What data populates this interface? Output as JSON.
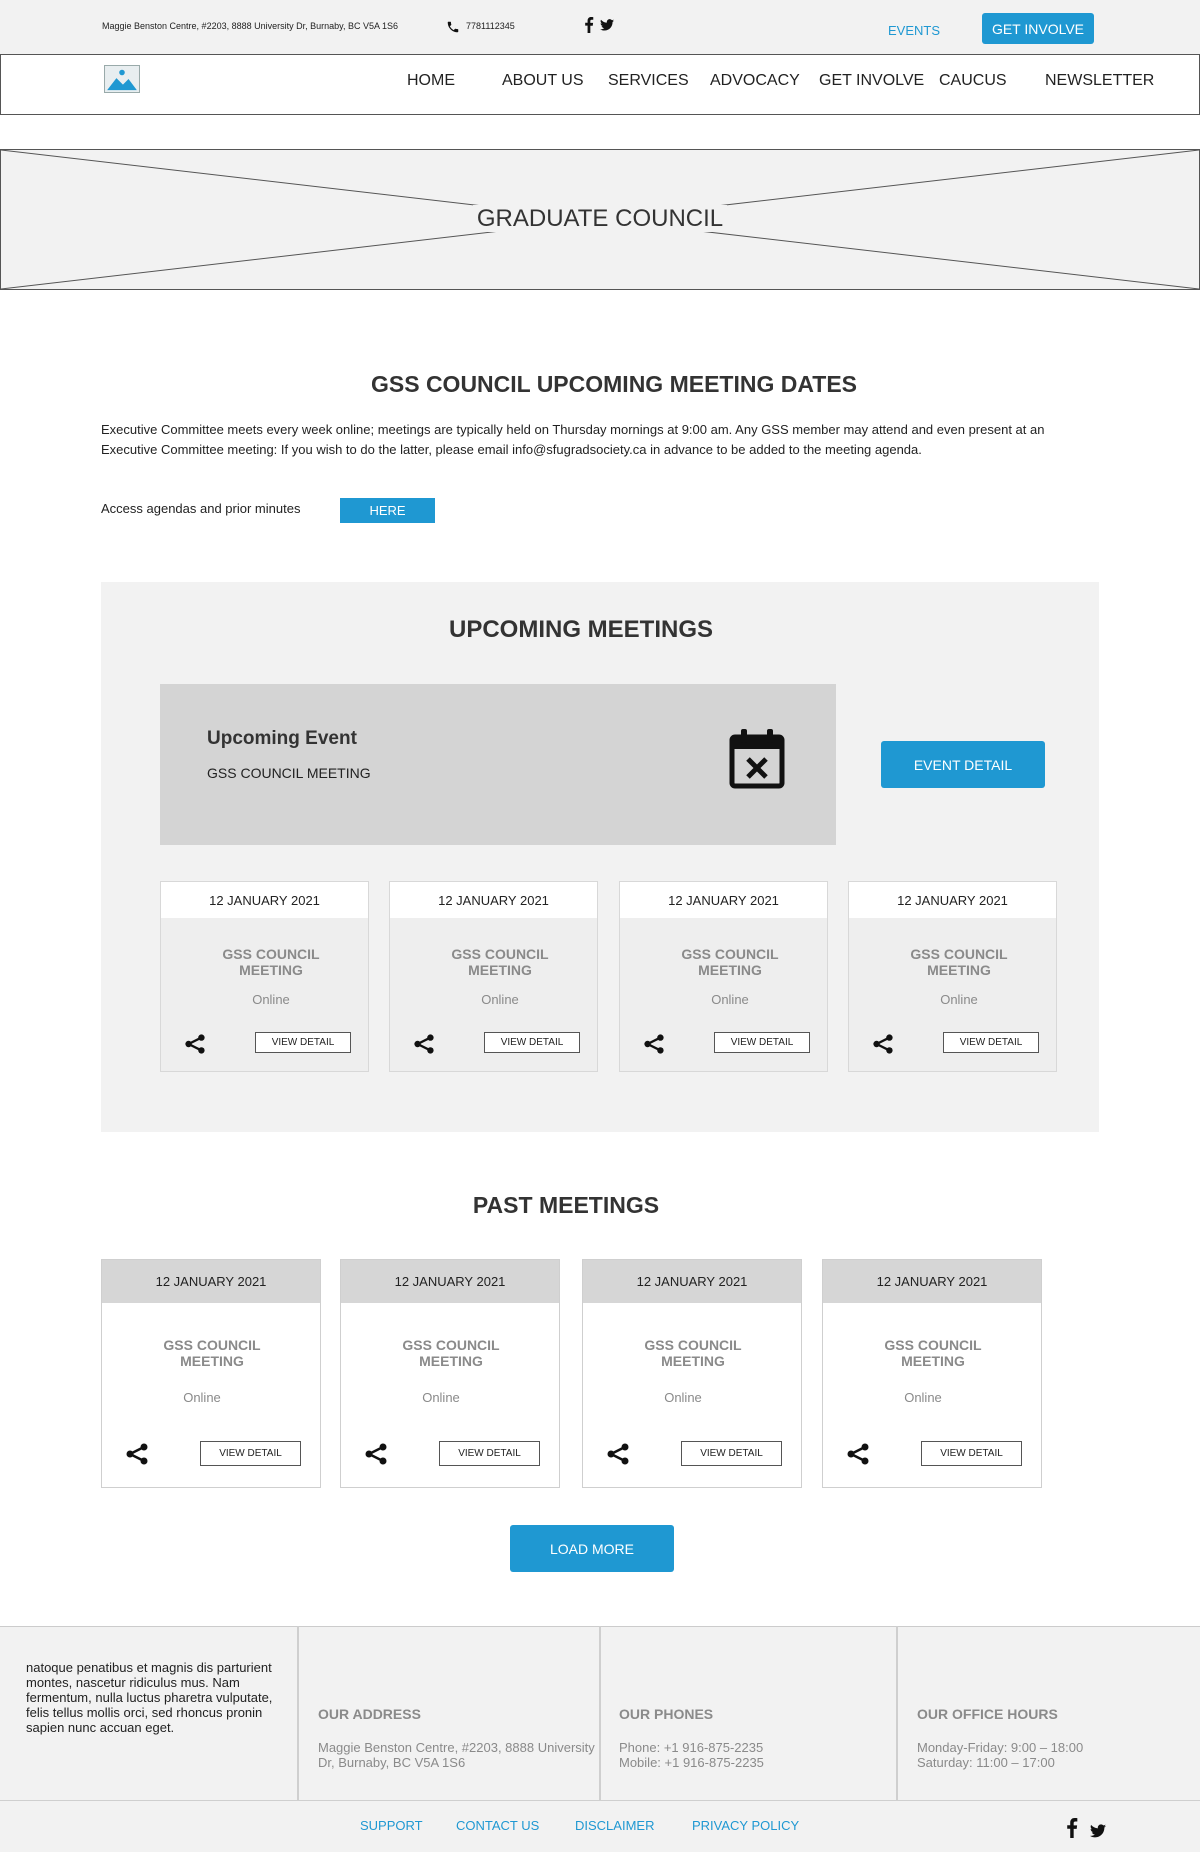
{
  "topbar": {
    "address": "Maggie Benston Centre, #2203, 8888 University Dr, Burnaby, BC V5A 1S6",
    "phone": "7781112345",
    "events_link": "EVENTS",
    "get_involve_button": "GET INVOLVE"
  },
  "nav": {
    "items": [
      "HOME",
      "ABOUT US",
      "SERVICES",
      "ADVOCACY",
      "GET INVOLVE",
      "CAUCUS",
      "NEWSLETTER"
    ]
  },
  "hero": {
    "title": "GRADUATE COUNCIL"
  },
  "meeting_dates": {
    "title": "GSS COUNCIL UPCOMING MEETING DATES",
    "description": "Executive Committee meets every week online; meetings are typically held on Thursday mornings at 9:00 am. Any GSS member may attend and even present at an Executive Committee meeting: If you wish to do the latter, please email info@sfugradsociety.ca in advance to be added to the meeting agenda.",
    "access_label": "Access agendas and prior minutes",
    "here_button": "HERE"
  },
  "upcoming": {
    "title": "UPCOMING MEETINGS",
    "featured": {
      "heading": "Upcoming Event",
      "name": "GSS COUNCIL MEETING",
      "detail_button": "EVENT DETAIL"
    },
    "cards": [
      {
        "date": "12 JANUARY 2021",
        "title": "GSS COUNCIL MEETING",
        "location": "Online",
        "button": "VIEW DETAIL"
      },
      {
        "date": "12 JANUARY 2021",
        "title": "GSS COUNCIL MEETING",
        "location": "Online",
        "button": "VIEW DETAIL"
      },
      {
        "date": "12 JANUARY 2021",
        "title": "GSS COUNCIL MEETING",
        "location": "Online",
        "button": "VIEW DETAIL"
      },
      {
        "date": "12 JANUARY 2021",
        "title": "GSS COUNCIL MEETING",
        "location": "Online",
        "button": "VIEW DETAIL"
      }
    ]
  },
  "past": {
    "title": "PAST MEETINGS",
    "cards": [
      {
        "date": "12 JANUARY 2021",
        "title": "GSS COUNCIL MEETING",
        "location": "Online",
        "button": "VIEW DETAIL"
      },
      {
        "date": "12 JANUARY 2021",
        "title": "GSS COUNCIL MEETING",
        "location": "Online",
        "button": "VIEW DETAIL"
      },
      {
        "date": "12 JANUARY 2021",
        "title": "GSS COUNCIL MEETING",
        "location": "Online",
        "button": "VIEW DETAIL"
      },
      {
        "date": "12 JANUARY 2021",
        "title": "GSS COUNCIL MEETING",
        "location": "Online",
        "button": "VIEW DETAIL"
      }
    ],
    "load_more_button": "LOAD MORE"
  },
  "footer": {
    "about": "natoque penatibus et magnis dis parturient montes, nascetur ridiculus mus. Nam fermentum, nulla luctus pharetra vulputate, felis tellus mollis orci, sed rhoncus pronin sapien nunc accuan eget.",
    "address": {
      "heading": "OUR ADDRESS",
      "line1": "Maggie Benston Centre, #2203, 8888 University",
      "line2": "Dr, Burnaby, BC V5A 1S6"
    },
    "phones": {
      "heading": "OUR PHONES",
      "phone": "Phone: +1 916-875-2235",
      "mobile": "Mobile: +1 916-875-2235"
    },
    "hours": {
      "heading": "OUR OFFICE HOURS",
      "weekdays": "Monday-Friday: 9:00 – 18:00",
      "saturday": "Saturday: 11:00 – 17:00"
    },
    "links": [
      "SUPPORT",
      "CONTACT US",
      "DISCLAIMER",
      "PRIVACY POLICY"
    ]
  },
  "icons": {
    "phone": "phone-icon",
    "facebook": "facebook-icon",
    "twitter": "twitter-icon",
    "logo": "image-placeholder-icon",
    "calendar": "calendar-cancel-icon",
    "share": "share-icon"
  },
  "colors": {
    "accent": "#1f98d2",
    "panel": "#f2f2f2",
    "featured_box": "#d4d4d4",
    "muted_text": "#8a8a8a"
  }
}
